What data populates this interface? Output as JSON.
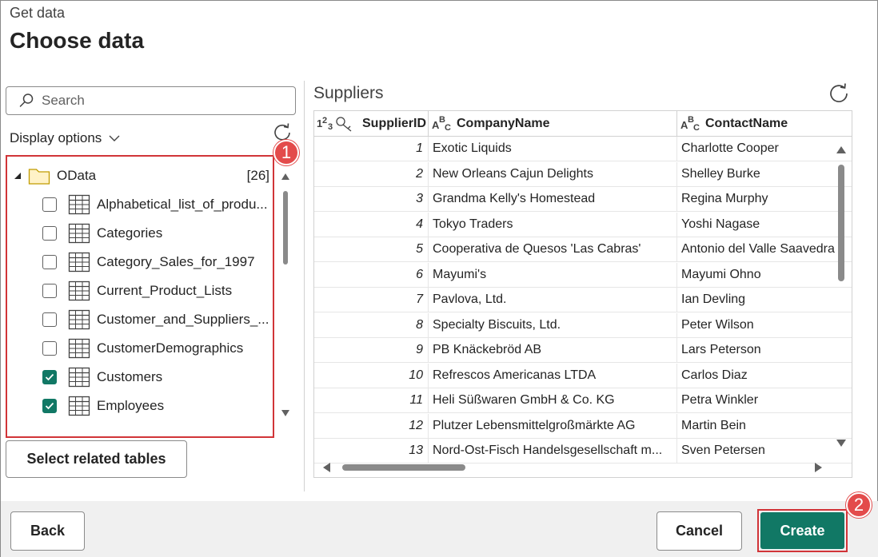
{
  "header": {
    "subtitle": "Get data",
    "title": "Choose data"
  },
  "left_panel": {
    "search_placeholder": "Search",
    "display_options_label": "Display options",
    "tree": {
      "root_label": "OData",
      "root_count": "[26]",
      "items": [
        {
          "label": "Alphabetical_list_of_produ...",
          "checked": false
        },
        {
          "label": "Categories",
          "checked": false
        },
        {
          "label": "Category_Sales_for_1997",
          "checked": false
        },
        {
          "label": "Current_Product_Lists",
          "checked": false
        },
        {
          "label": "Customer_and_Suppliers_...",
          "checked": false
        },
        {
          "label": "CustomerDemographics",
          "checked": false
        },
        {
          "label": "Customers",
          "checked": true
        },
        {
          "label": "Employees",
          "checked": true
        }
      ]
    },
    "select_related_label": "Select related tables",
    "badge_1": "1"
  },
  "preview": {
    "title": "Suppliers",
    "columns": [
      {
        "type_icon": "123 key",
        "name": "SupplierID"
      },
      {
        "type_icon": "ABC",
        "name": "CompanyName"
      },
      {
        "type_icon": "ABC",
        "name": "ContactName"
      }
    ],
    "rows": [
      [
        "1",
        "Exotic Liquids",
        "Charlotte Cooper"
      ],
      [
        "2",
        "New Orleans Cajun Delights",
        "Shelley Burke"
      ],
      [
        "3",
        "Grandma Kelly's Homestead",
        "Regina Murphy"
      ],
      [
        "4",
        "Tokyo Traders",
        "Yoshi Nagase"
      ],
      [
        "5",
        "Cooperativa de Quesos 'Las Cabras'",
        "Antonio del Valle Saavedra"
      ],
      [
        "6",
        "Mayumi's",
        "Mayumi Ohno"
      ],
      [
        "7",
        "Pavlova, Ltd.",
        "Ian Devling"
      ],
      [
        "8",
        "Specialty Biscuits, Ltd.",
        "Peter Wilson"
      ],
      [
        "9",
        "PB Knäckebröd AB",
        "Lars Peterson"
      ],
      [
        "10",
        "Refrescos Americanas LTDA",
        "Carlos Diaz"
      ],
      [
        "11",
        "Heli Süßwaren GmbH & Co. KG",
        "Petra Winkler"
      ],
      [
        "12",
        "Plutzer Lebensmittelgroßmärkte AG",
        "Martin Bein"
      ],
      [
        "13",
        "Nord-Ost-Fisch Handelsgesellschaft m...",
        "Sven Petersen"
      ]
    ]
  },
  "footer": {
    "back_label": "Back",
    "cancel_label": "Cancel",
    "create_label": "Create",
    "badge_2": "2"
  },
  "colors": {
    "accent": "#117865",
    "highlight": "#d13438",
    "badge": "#e34b4b"
  }
}
